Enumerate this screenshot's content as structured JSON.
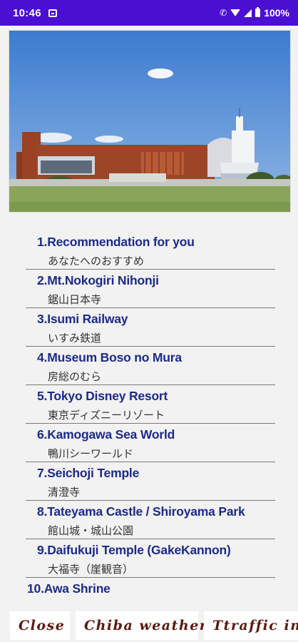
{
  "status": {
    "time": "10:46",
    "battery": "100%"
  },
  "hero": {
    "icon": "museum-photo"
  },
  "menu": [
    {
      "en": "1.Recommendation for you",
      "ja": "あなたへのおすすめ"
    },
    {
      "en": "2.Mt.Nokogiri Nihonji",
      "ja": "鋸山日本寺"
    },
    {
      "en": "3.Isumi Railway",
      "ja": "いすみ鉄道"
    },
    {
      "en": "4.Museum Boso no Mura",
      "ja": "房総のむら"
    },
    {
      "en": "5.Tokyo Disney Resort",
      "ja": "東京ディズニーリゾート"
    },
    {
      "en": "6.Kamogawa Sea World",
      "ja": "鴨川シーワールド"
    },
    {
      "en": "7.Seichoji Temple",
      "ja": "清澄寺"
    },
    {
      "en": "8.Tateyama Castle / Shiroyama Park",
      "ja": "館山城・城山公園"
    },
    {
      "en": "9.Daifukuji Temple (GakeKannon)",
      "ja": "大福寺（崖観音）"
    },
    {
      "en": "10.Awa Shrine"
    }
  ],
  "buttons": {
    "close": "Close",
    "weather": "Chiba weather",
    "traffic": "Ttraffic info"
  },
  "colors": {
    "status_bar": "#4a0fd0",
    "item_text": "#1c2a8c",
    "button_text": "#5c1810"
  }
}
